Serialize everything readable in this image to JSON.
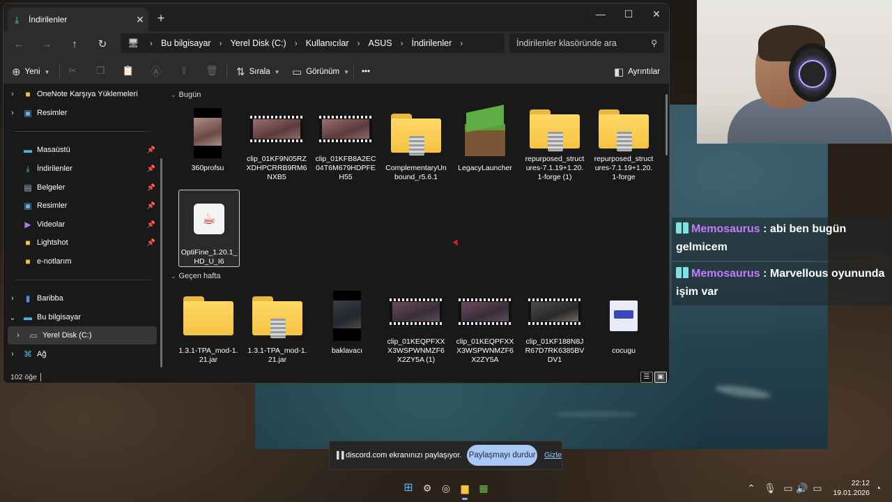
{
  "chat": {
    "messages": [
      {
        "user": "Memosaurus",
        "text": " : abi ben bugün gelmicem"
      },
      {
        "user": "Memosaurus",
        "text": " : Marvellous oyununda işim var"
      }
    ]
  },
  "window": {
    "tab_title": "İndirilenler",
    "new_tab": "+",
    "minimize": "—",
    "maximize": "☐",
    "close": "✕"
  },
  "nav": {
    "back": "←",
    "forward": "→",
    "up": "↑",
    "refresh": "↻",
    "breadcrumb": [
      "Bu bilgisayar",
      "Yerel Disk (C:)",
      "Kullanıcılar",
      "ASUS",
      "İndirilenler"
    ],
    "search_placeholder": "İndirilenler klasöründe ara"
  },
  "toolbar": {
    "new_label": "Yeni",
    "sort_label": "Sırala",
    "view_label": "Görünüm",
    "more_label": "•••",
    "details_label": "Ayrıntılar"
  },
  "sidebar": {
    "items": [
      {
        "label": "OneNote Karşıya Yüklemeleri",
        "icon": "folder-icon"
      },
      {
        "label": "Resimler",
        "icon": "pictures-icon"
      },
      {
        "label": "Masaüstü",
        "icon": "desktop-icon"
      },
      {
        "label": "İndirilenler",
        "icon": "download-icon"
      },
      {
        "label": "Belgeler",
        "icon": "documents-icon"
      },
      {
        "label": "Resimler",
        "icon": "pictures-icon"
      },
      {
        "label": "Videolar",
        "icon": "videos-icon"
      },
      {
        "label": "Lightshot",
        "icon": "folder-icon"
      },
      {
        "label": "e-notlarım",
        "icon": "folder-icon"
      },
      {
        "label": "Baribba",
        "icon": "phone-icon"
      },
      {
        "label": "Bu bilgisayar",
        "icon": "computer-icon"
      },
      {
        "label": "Yerel Disk (C:)",
        "icon": "drive-icon"
      },
      {
        "label": "Ağ",
        "icon": "network-icon"
      }
    ]
  },
  "content": {
    "groups": [
      {
        "title": "Bugün",
        "files": [
          {
            "name": "360profsu",
            "type": "video-portrait"
          },
          {
            "name": "clip_01KF9N05RZXDHPCRRB9RM6NXB5",
            "type": "video"
          },
          {
            "name": "clip_01KFB8A2EC04T6M679HDPFEH55",
            "type": "video"
          },
          {
            "name": "ComplementaryUnbound_r5.6.1",
            "type": "zip"
          },
          {
            "name": "LegacyLauncher",
            "type": "minecraft"
          },
          {
            "name": "repurposed_structures-7.1.19+1.20.1-forge (1)",
            "type": "zip"
          },
          {
            "name": "repurposed_structures-7.1.19+1.20.1-forge",
            "type": "zip"
          },
          {
            "name": "OptiFine_1.20.1_HD_U_I6",
            "type": "java"
          }
        ]
      },
      {
        "title": "Geçen hafta",
        "files": [
          {
            "name": "1.3.1-TPA_mod-1.21.jar",
            "type": "folder"
          },
          {
            "name": "1.3.1-TPA_mod-1.21.jar",
            "type": "zip"
          },
          {
            "name": "baklavacı",
            "type": "video-portrait"
          },
          {
            "name": "clip_01KEQPFXXX3WSPWNMZF6X2ZY5A (1)",
            "type": "video"
          },
          {
            "name": "clip_01KEQPFXXX3WSPWNMZF6X2ZY5A",
            "type": "video"
          },
          {
            "name": "clip_01KF188N8JR67D7RK6385BVDV1",
            "type": "video"
          },
          {
            "name": "cocugu",
            "type": "document"
          }
        ]
      }
    ]
  },
  "status": {
    "count": "102 öğe"
  },
  "share": {
    "text": "discord.com ekranınızı paylaşıyor.",
    "stop": "Paylaşmayı durdur",
    "hide": "Gizle"
  },
  "clock": {
    "time": "22:12",
    "date": "19.01.2026"
  }
}
